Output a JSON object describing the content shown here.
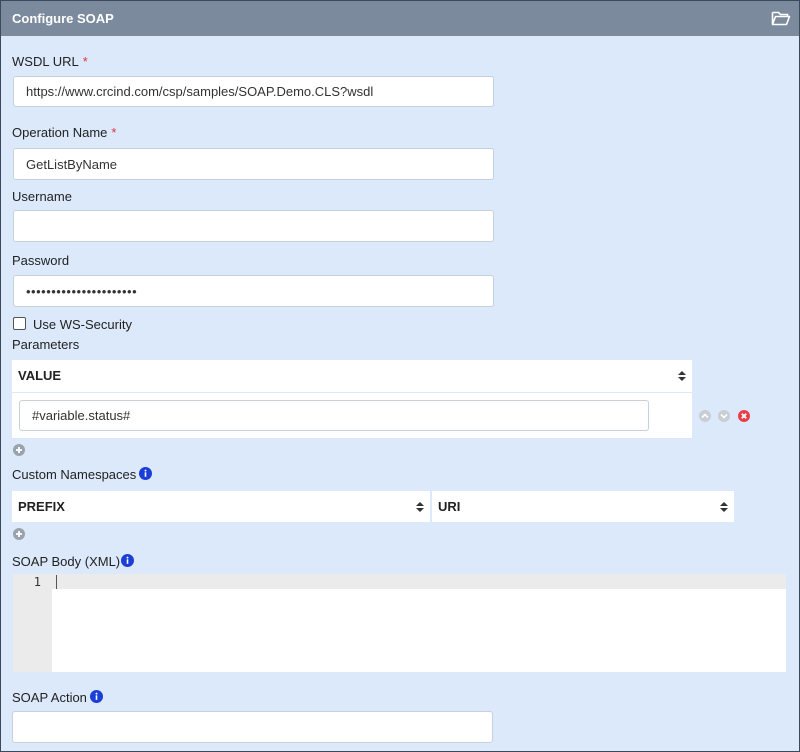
{
  "header": {
    "title": "Configure SOAP",
    "icon": "folder-open-icon"
  },
  "wsdl": {
    "label": "WSDL URL",
    "required": "*",
    "value": "https://www.crcind.com/csp/samples/SOAP.Demo.CLS?wsdl"
  },
  "operation": {
    "label": "Operation Name",
    "required": "*",
    "value": "GetListByName"
  },
  "username": {
    "label": "Username",
    "value": ""
  },
  "password": {
    "label": "Password",
    "value": "••••••••••••••••••••••"
  },
  "ws_security": {
    "label": "Use WS-Security",
    "checked": false
  },
  "parameters": {
    "label": "Parameters",
    "column": "VALUE",
    "rows": [
      {
        "value": "#variable.status#"
      }
    ]
  },
  "namespaces": {
    "label": "Custom Namespaces",
    "columns": [
      "PREFIX",
      "URI"
    ]
  },
  "soap_body": {
    "label": "SOAP Body (XML)",
    "line_number": "1",
    "content": ""
  },
  "soap_action": {
    "label": "SOAP Action",
    "value": ""
  },
  "colors": {
    "header_bg": "#7b8a9c",
    "panel_bg": "#dce9fb",
    "info": "#1a3ed6",
    "delete": "#e8404a",
    "required": "#d9363e"
  }
}
